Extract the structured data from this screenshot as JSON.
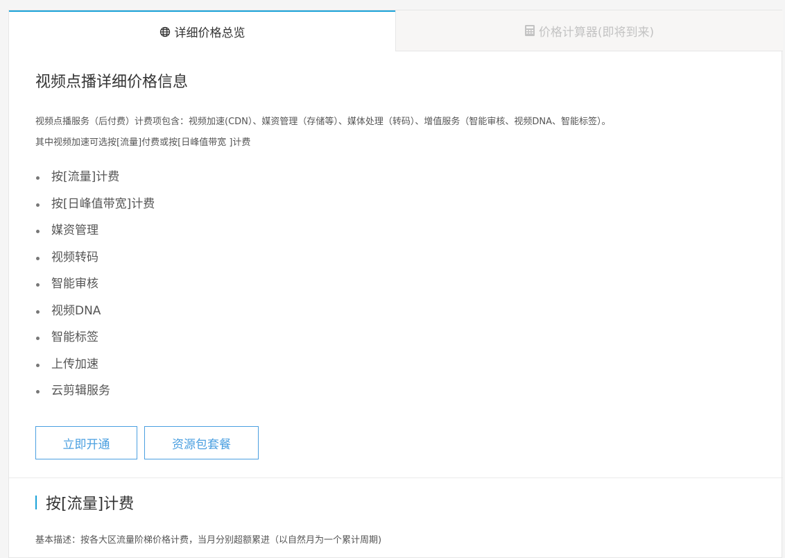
{
  "tabs": [
    {
      "label": "详细价格总览",
      "icon": "globe-icon",
      "active": true
    },
    {
      "label": "价格计算器(即将到来)",
      "icon": "calculator-icon",
      "active": false
    }
  ],
  "main": {
    "title": "视频点播详细价格信息",
    "description_line1": "视频点播服务（后付费）计费项包含：视频加速(CDN）、媒资管理（存储等）、媒体处理（转码）、增值服务（智能审核、视频DNA、智能标签）。",
    "description_line2": "其中视频加速可选按[流量]付费或按[日峰值带宽 ]计费",
    "items": [
      "按[流量]计费",
      "按[日峰值带宽]计费",
      "媒资管理",
      "视频转码",
      "智能审核",
      "视频DNA",
      "智能标签",
      "上传加速",
      "云剪辑服务"
    ],
    "buttons": {
      "open": "立即开通",
      "package": "资源包套餐"
    }
  },
  "section": {
    "title": "按[流量]计费",
    "basic_desc": "基本描述：按各大区流量阶梯价格计费，当月分别超额累进（以自然月为一个累计周期)"
  },
  "colors": {
    "accent": "#1aa2d8",
    "button": "#4a9fe0",
    "inactive_tab_bg": "#f7f6f5"
  }
}
